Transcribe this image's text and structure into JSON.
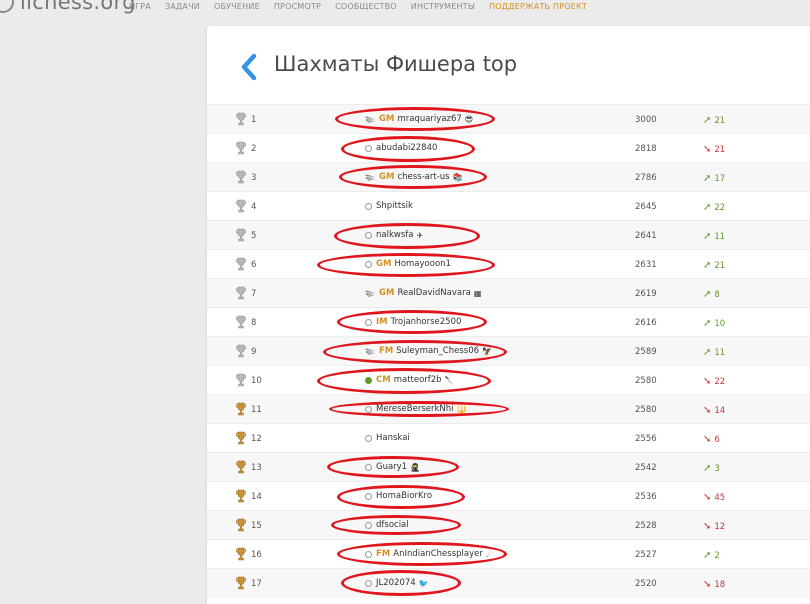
{
  "site": {
    "logo": "lichess.org"
  },
  "nav": [
    {
      "label": "ИГРА",
      "accent": false
    },
    {
      "label": "ЗАДАЧИ",
      "accent": false
    },
    {
      "label": "ОБУЧЕНИЕ",
      "accent": false
    },
    {
      "label": "ПРОСМОТР",
      "accent": false
    },
    {
      "label": "СООБЩЕСТВО",
      "accent": false
    },
    {
      "label": "ИНСТРУМЕНТЫ",
      "accent": false
    },
    {
      "label": "ПОДДЕРЖАТЬ ПРОЕКТ",
      "accent": true
    }
  ],
  "page": {
    "title": "Шахматы Фишера top"
  },
  "colors": {
    "accent": "#d59020",
    "up": "#629924",
    "down": "#cc3333",
    "highlight": "#e0161c"
  },
  "rows": [
    {
      "rank": "1",
      "trophy": "silver",
      "status": "patron",
      "title": "GM",
      "name": "mraquariyaz67",
      "flair": "😎",
      "rating": "3000",
      "dir": "up",
      "progress": "21"
    },
    {
      "rank": "2",
      "trophy": "silver",
      "status": "offline",
      "title": "",
      "name": "abudabi22840",
      "flair": "",
      "rating": "2818",
      "dir": "down",
      "progress": "21"
    },
    {
      "rank": "3",
      "trophy": "silver",
      "status": "patron",
      "title": "GM",
      "name": "chess-art-us",
      "flair": "📚",
      "rating": "2786",
      "dir": "up",
      "progress": "17"
    },
    {
      "rank": "4",
      "trophy": "silver",
      "status": "offline",
      "title": "",
      "name": "Shpittsik",
      "flair": "",
      "rating": "2645",
      "dir": "up",
      "progress": "22"
    },
    {
      "rank": "5",
      "trophy": "silver",
      "status": "offline",
      "title": "",
      "name": "nalkwsfa",
      "flair": "✈",
      "rating": "2641",
      "dir": "up",
      "progress": "11"
    },
    {
      "rank": "6",
      "trophy": "silver",
      "status": "offline",
      "title": "GM",
      "name": "Homayooon1",
      "flair": "",
      "rating": "2631",
      "dir": "up",
      "progress": "21"
    },
    {
      "rank": "7",
      "trophy": "silver",
      "status": "patron",
      "title": "GM",
      "name": "RealDavidNavara",
      "flair": "▦",
      "rating": "2619",
      "dir": "up",
      "progress": "8"
    },
    {
      "rank": "8",
      "trophy": "silver",
      "status": "offline",
      "title": "IM",
      "name": "Trojanhorse2500",
      "flair": "",
      "rating": "2616",
      "dir": "up",
      "progress": "10"
    },
    {
      "rank": "9",
      "trophy": "silver",
      "status": "patron",
      "title": "FM",
      "name": "Suleyman_Chess06",
      "flair": "🦅",
      "rating": "2589",
      "dir": "up",
      "progress": "11"
    },
    {
      "rank": "10",
      "trophy": "silver",
      "status": "online",
      "title": "CM",
      "name": "matteorf2b",
      "flair": "🔪",
      "rating": "2580",
      "dir": "down",
      "progress": "22"
    },
    {
      "rank": "11",
      "trophy": "bronze",
      "status": "offline",
      "title": "",
      "name": "MereseBerserkNhi",
      "flair": "🔱",
      "rating": "2580",
      "dir": "down",
      "progress": "14"
    },
    {
      "rank": "12",
      "trophy": "bronze",
      "status": "offline",
      "title": "",
      "name": "Hanskai",
      "flair": "",
      "rating": "2556",
      "dir": "down",
      "progress": "6"
    },
    {
      "rank": "13",
      "trophy": "bronze",
      "status": "offline",
      "title": "",
      "name": "Guary1",
      "flair": "🥷",
      "rating": "2542",
      "dir": "up",
      "progress": "3"
    },
    {
      "rank": "14",
      "trophy": "bronze",
      "status": "offline",
      "title": "",
      "name": "HomaBiorKro",
      "flair": "",
      "rating": "2536",
      "dir": "down",
      "progress": "45"
    },
    {
      "rank": "15",
      "trophy": "bronze",
      "status": "offline",
      "title": "",
      "name": "dfsocial",
      "flair": "",
      "rating": "2528",
      "dir": "down",
      "progress": "12"
    },
    {
      "rank": "16",
      "trophy": "bronze",
      "status": "offline",
      "title": "FM",
      "name": "AnIndianChessplayer",
      "flair": "☄",
      "rating": "2527",
      "dir": "up",
      "progress": "2"
    },
    {
      "rank": "17",
      "trophy": "bronze",
      "status": "offline",
      "title": "",
      "name": "JL202074",
      "flair": "🐦",
      "rating": "2520",
      "dir": "down",
      "progress": "18"
    }
  ]
}
